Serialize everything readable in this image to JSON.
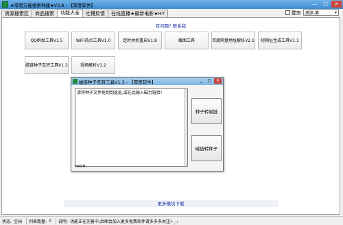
{
  "app": {
    "title": "★零度万能搜索神器★V3.8 - 【零度软件】",
    "window_controls": {
      "minimize": "—",
      "maximize": "□",
      "close": "✕"
    }
  },
  "tabs": [
    {
      "label": "资源搜索区"
    },
    {
      "label": "商品搜索"
    },
    {
      "label": "功能大全"
    },
    {
      "label": "吐槽反馈"
    },
    {
      "label": "在线直播★最新电影★HY"
    }
  ],
  "topright": {
    "pin_label": "置顶",
    "skin_value": "皮肤-紫",
    "skin_arrow": "▾"
  },
  "main": {
    "help_link": "有问题? 联系我",
    "tools": [
      {
        "label": "QQ群发工具V1.5"
      },
      {
        "label": "WIFI热点工具V1.0"
      },
      {
        "label": "定时关机重启V1.8"
      },
      {
        "label": "截图工具"
      },
      {
        "label": "百度网盘地址解析V2.1"
      },
      {
        "label": "短网址生成工具V1.1"
      },
      {
        "label": "磁链种子互转工具V1.3"
      },
      {
        "label": "视频解析V1.2"
      }
    ],
    "more_link": "更多模块下载"
  },
  "dialog": {
    "title": "磁链种子互转工具V1.3 - 【零度软件】",
    "controls": {
      "minimize": "_",
      "maximize": "□",
      "close": "✕"
    },
    "text_content": "请将种子文件拖到到此处,或在此输入磁力链接!",
    "btn_seed_to_magnet": "种子转磁链",
    "btn_magnet_to_seed": "磁链转种子",
    "hash_label": "HASH:"
  },
  "status": {
    "state_label": "状态:",
    "state_value": "空闲",
    "count_label": "列表数量:",
    "count_value": "0",
    "desc_label": "说明:",
    "desc_value": "功能正在完善中,后续会加入更多免费软件请多多多关注!-_-:"
  },
  "colors": {
    "titlebar": "#3e8ad4",
    "link": "#1a2fa8",
    "close": "#c9463d"
  }
}
